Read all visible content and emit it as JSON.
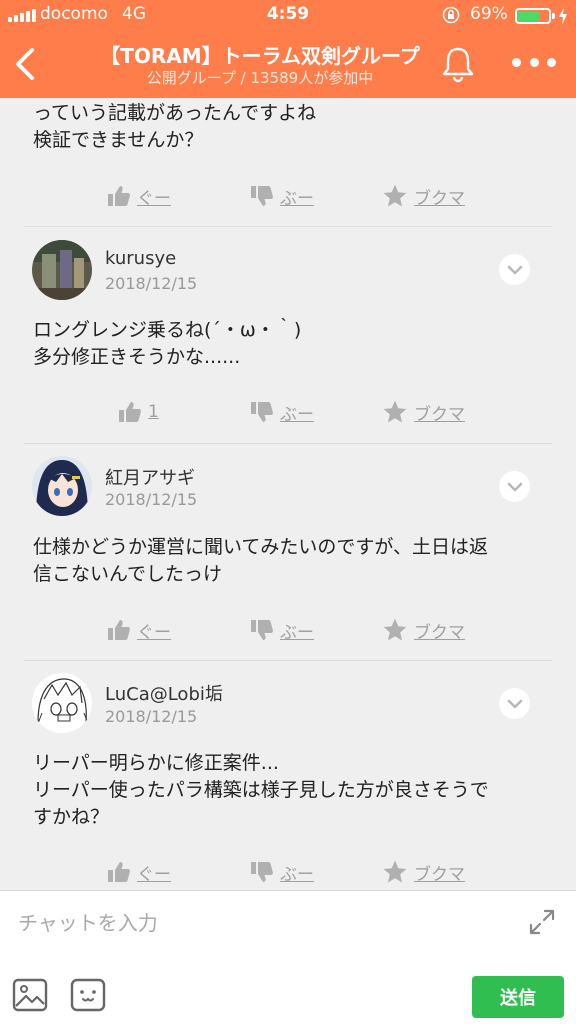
{
  "status_bar": {
    "carrier": "docomo",
    "network": "4G",
    "time": "4:59",
    "battery_percent": "69%",
    "battery_level": 0.69
  },
  "header": {
    "title": "【TORAM】トーラム双剣グループ",
    "subtitle": "公開グループ / 13589人が参加中"
  },
  "posts": [
    {
      "text": "っていう記載があったんですよね\n検証できませんか？",
      "like_label": "ぐー",
      "dislike_label": "ぶー",
      "bookmark_label": "ブクマ"
    },
    {
      "author": "kurusye",
      "date": "2018/12/15",
      "text": "ロングレンジ乗るね(´・ω・｀)\n多分修正きそうかな......",
      "like_label": "1",
      "dislike_label": "ぶー",
      "bookmark_label": "ブクマ"
    },
    {
      "author": "紅月アサギ",
      "date": "2018/12/15",
      "text": "仕様かどうか運営に聞いてみたいのですが、土日は返\n信こないんでしたっけ",
      "like_label": "ぐー",
      "dislike_label": "ぶー",
      "bookmark_label": "ブクマ"
    },
    {
      "author": "LuCa@Lobi垢",
      "date": "2018/12/15",
      "text": "リーパー明らかに修正案件...\nリーパー使ったパラ構築は様子見した方が良さそうで\nすかね？",
      "like_label": "ぐー",
      "dislike_label": "ぶー",
      "bookmark_label": "ブクマ"
    }
  ],
  "composer": {
    "placeholder": "チャットを入力",
    "send_label": "送信"
  },
  "colors": {
    "header": "#ff7d4a",
    "send_button": "#2fbe4f",
    "reaction_gray": "#a0a0a0"
  },
  "icons": [
    "signal-icon",
    "lock-rotation-icon",
    "battery-icon",
    "charging-icon",
    "back-arrow-icon",
    "bell-icon",
    "more-dots-icon",
    "thumbs-up-icon",
    "thumbs-down-icon",
    "star-icon",
    "chevron-down-icon",
    "expand-icon",
    "image-icon",
    "emoji-icon"
  ]
}
